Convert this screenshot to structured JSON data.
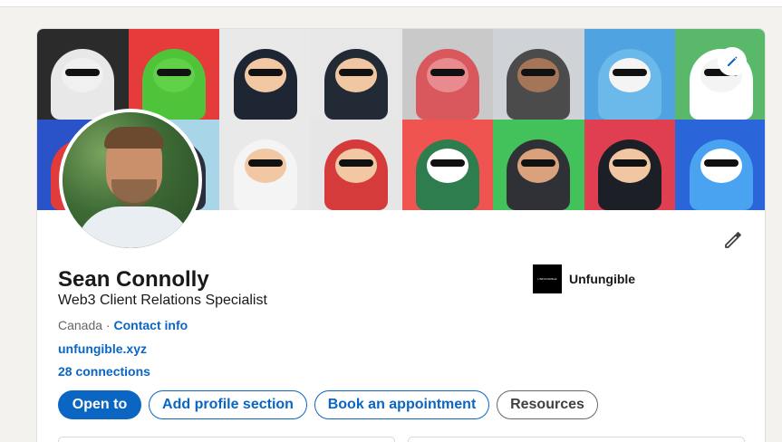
{
  "profile": {
    "name": "Sean Connolly",
    "headline": "Web3 Client Relations Specialist",
    "location": "Canada",
    "separator": " · ",
    "contact_info": "Contact info",
    "website": "unfungible.xyz",
    "connections": "28 connections"
  },
  "company": {
    "name": "Unfungible",
    "logo_text": "UNFUNGIBLE"
  },
  "actions": {
    "open_to": "Open to",
    "add_section": "Add profile section",
    "book": "Book an appointment",
    "resources": "Resources"
  },
  "banner": {
    "tiles": [
      {
        "bg": "#2b2b2b",
        "fig": "#e8e8e8",
        "face": "#f0f0f0"
      },
      {
        "bg": "#e63b3b",
        "fig": "#4fc43a",
        "face": "#5fd048"
      },
      {
        "bg": "#e9e9e9",
        "fig": "#1e2533",
        "face": "#f2c8a4"
      },
      {
        "bg": "#e7e7e7",
        "fig": "#222a36",
        "face": "#f0c7a2"
      },
      {
        "bg": "#c9c9c9",
        "fig": "#d9585e",
        "face": "#e98a8f"
      },
      {
        "bg": "#cfd2d6",
        "fig": "#4b4b4b",
        "face": "#a57558"
      },
      {
        "bg": "#4ea3e0",
        "fig": "#6bb8ea",
        "face": "#f4f4f4"
      },
      {
        "bg": "#59b86a",
        "fig": "#ffffff",
        "face": "#f4f4f4"
      },
      {
        "bg": "#2a52c9",
        "fig": "#e23b3b",
        "face": "#f3c7a0"
      },
      {
        "bg": "#a8d6e8",
        "fig": "#2a2f3a",
        "face": "#f2c8a4"
      },
      {
        "bg": "#e9e9e9",
        "fig": "#f4f4f4",
        "face": "#f2c8a4"
      },
      {
        "bg": "#e6e6e6",
        "fig": "#d63b3b",
        "face": "#f2c8a4"
      },
      {
        "bg": "#ef5451",
        "fig": "#2e7d4f",
        "face": "#ffffff"
      },
      {
        "bg": "#43c25c",
        "fig": "#2f3136",
        "face": "#d9a27c"
      },
      {
        "bg": "#e03f52",
        "fig": "#1c1f26",
        "face": "#f0c7a2"
      },
      {
        "bg": "#2a66d9",
        "fig": "#4aa3f0",
        "face": "#ffffff"
      }
    ]
  }
}
